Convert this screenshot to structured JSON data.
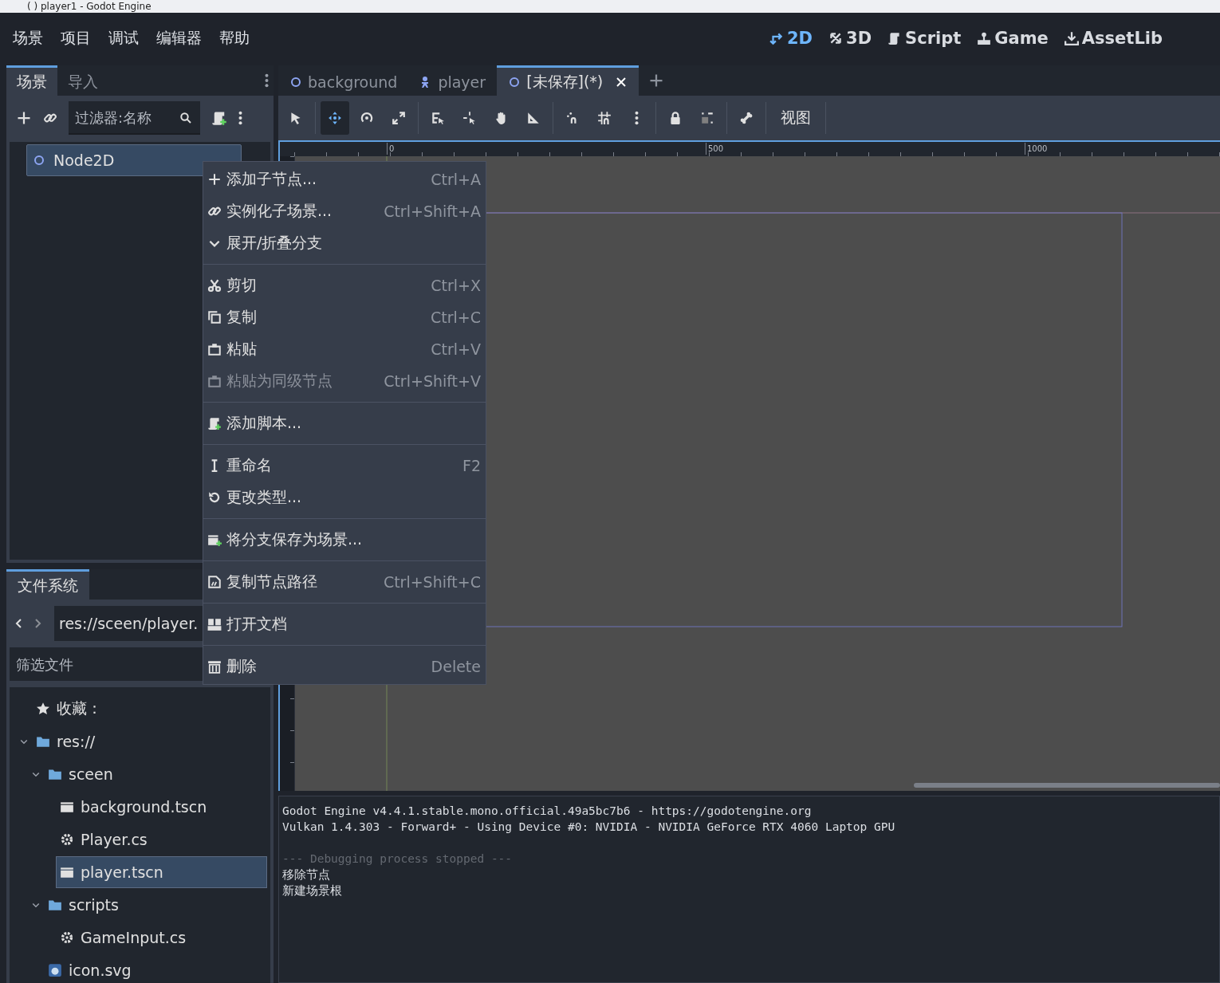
{
  "window": {
    "title": "( ) player1 - Godot Engine"
  },
  "menu": [
    "场景",
    "项目",
    "调试",
    "编辑器",
    "帮助"
  ],
  "workspaces": [
    {
      "label": "2D",
      "selected": true
    },
    {
      "label": "3D",
      "selected": false
    },
    {
      "label": "Script",
      "selected": false
    },
    {
      "label": "Game",
      "selected": false
    },
    {
      "label": "AssetLib",
      "selected": false
    }
  ],
  "scene_dock": {
    "tabs": [
      {
        "label": "场景",
        "selected": true
      },
      {
        "label": "导入",
        "selected": false
      }
    ],
    "filter": {
      "placeholder": "过滤器:名称"
    },
    "tree": [
      {
        "label": "Node2D",
        "selected": true
      }
    ]
  },
  "filesystem": {
    "tab": "文件系统",
    "path": "res://sceen/player.",
    "filter": {
      "placeholder": "筛选文件"
    },
    "tree": [
      {
        "label": "收藏：",
        "kind": "favorites"
      },
      {
        "label": "res://",
        "kind": "folder",
        "expanded": true,
        "children": [
          {
            "label": "sceen",
            "kind": "folder",
            "expanded": true,
            "children": [
              {
                "label": "background.tscn",
                "kind": "scene",
                "selected": false
              },
              {
                "label": "Player.cs",
                "kind": "script",
                "selected": false
              },
              {
                "label": "player.tscn",
                "kind": "scene",
                "selected": true
              }
            ]
          },
          {
            "label": "scripts",
            "kind": "folder",
            "expanded": true,
            "children": [
              {
                "label": "GameInput.cs",
                "kind": "script",
                "selected": false
              }
            ]
          },
          {
            "label": "icon.svg",
            "kind": "image",
            "selected": false
          }
        ]
      }
    ]
  },
  "editor_tabs": [
    {
      "label": "background",
      "kind": "node",
      "selected": false
    },
    {
      "label": "player",
      "kind": "sprite",
      "selected": false
    },
    {
      "label": "[未保存](*)",
      "kind": "node",
      "selected": true
    }
  ],
  "toolbar": {
    "groups": [
      [
        {
          "selected": false
        }
      ],
      [
        {
          "selected": true
        },
        {
          "selected": false
        },
        {
          "selected": false
        }
      ],
      [
        {
          "selected": false
        },
        {
          "selected": false
        },
        {
          "selected": false
        },
        {
          "selected": false
        }
      ],
      [
        {
          "selected": false
        },
        {
          "selected": false
        },
        {
          "selected": false
        }
      ],
      [
        {
          "selected": false
        },
        {
          "selected": false
        }
      ],
      [
        {
          "selected": false
        }
      ]
    ],
    "view_menu": "视图"
  },
  "ruler": {
    "marks": [
      "0",
      "500",
      "1000"
    ]
  },
  "context_menu": {
    "groups": [
      [
        {
          "label": "添加子节点...",
          "shortcut": "Ctrl+A",
          "disabled": false
        },
        {
          "label": "实例化子场景...",
          "shortcut": "Ctrl+Shift+A",
          "disabled": false
        },
        {
          "label": "展开/折叠分支",
          "disabled": false
        }
      ],
      [
        {
          "label": "剪切",
          "shortcut": "Ctrl+X",
          "disabled": false
        },
        {
          "label": "复制",
          "shortcut": "Ctrl+C",
          "disabled": false
        },
        {
          "label": "粘贴",
          "shortcut": "Ctrl+V",
          "disabled": false
        },
        {
          "label": "粘贴为同级节点",
          "shortcut": "Ctrl+Shift+V",
          "disabled": true
        }
      ],
      [
        {
          "label": "添加脚本...",
          "disabled": false
        }
      ],
      [
        {
          "label": "重命名",
          "shortcut": "F2",
          "disabled": false
        },
        {
          "label": "更改类型...",
          "disabled": false
        }
      ],
      [
        {
          "label": "将分支保存为场景...",
          "disabled": false
        }
      ],
      [
        {
          "label": "复制节点路径",
          "shortcut": "Ctrl+Shift+C",
          "disabled": false
        }
      ],
      [
        {
          "label": "打开文档",
          "disabled": false
        }
      ],
      [
        {
          "label": "删除",
          "shortcut": "Delete",
          "disabled": false
        }
      ]
    ]
  },
  "console": [
    [
      {
        "text": "Godot Engine v4.4.1.stable.mono.official.49a5bc7b6 - https://godotengine.org",
        "kind": "info"
      },
      {
        "text": "Vulkan 1.4.303 - Forward+ - Using Device #0: NVIDIA - NVIDIA GeForce RTX 4060 Laptop GPU",
        "kind": "info"
      }
    ],
    [
      {
        "text": "--- Debugging process stopped ---",
        "kind": "dim"
      },
      {
        "text": "移除节点",
        "kind": "info"
      },
      {
        "text": "新建场景根",
        "kind": "info"
      }
    ]
  ]
}
